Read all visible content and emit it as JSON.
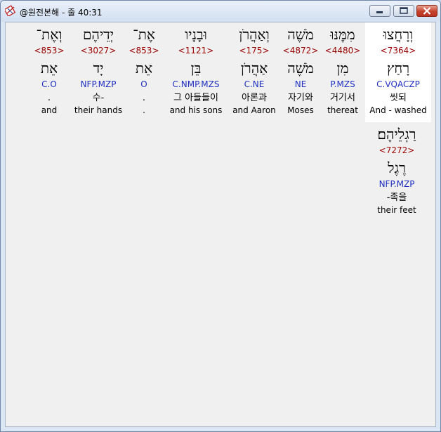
{
  "window": {
    "title": "@원전본해 - 줄 40:31",
    "icons": {
      "app": "app-icon",
      "minimize": "minimize-icon",
      "maximize": "maximize-icon",
      "close": "close-icon"
    }
  },
  "words": [
    {
      "hebrew": "וְרָחֲצוּ",
      "strong": "<7364>",
      "lemma": "רָחַץ",
      "morph": "C.VQACZP",
      "korean": "씻되",
      "english": "And - washed"
    },
    {
      "hebrew": "מִמֶּנּוּ",
      "strong": "<4480>",
      "lemma": "מִן",
      "morph": "P.MZS",
      "korean": "거기서",
      "english": "thereat"
    },
    {
      "hebrew": "מֹשֶׁה",
      "strong": "<4872>",
      "lemma": "מֹשֶׁה",
      "morph": "NE",
      "korean": "자기와",
      "english": "Moses"
    },
    {
      "hebrew": "וְאַהֲרֹן",
      "strong": "<175>",
      "lemma": "אַהֲרֹן",
      "morph": "C.NE",
      "korean": "아론과",
      "english": "and Aaron"
    },
    {
      "hebrew": "וּבָנָיו",
      "strong": "<1121>",
      "lemma": "בֵּן",
      "morph": "C.NMP.MZS",
      "korean": "그 아들들이",
      "english": "and his sons"
    },
    {
      "hebrew": "אֶת־",
      "strong": "<853>",
      "lemma": "אֵת",
      "morph": "O",
      "korean": ".",
      "english": "."
    },
    {
      "hebrew": "יְדֵיהֶם",
      "strong": "<3027>",
      "lemma": "יָד",
      "morph": "NFP.MZP",
      "korean": "수-",
      "english": "their hands"
    },
    {
      "hebrew": "וְאֶת־",
      "strong": "<853>",
      "lemma": "אֵת",
      "morph": "C.O",
      "korean": ".",
      "english": "and"
    },
    {
      "hebrew": "רַגְלֵיהֶם׃",
      "strong": "<7272>",
      "lemma": "רֶגֶל",
      "morph": "NFP.MZP",
      "korean": "-족을",
      "english": "their feet"
    }
  ]
}
